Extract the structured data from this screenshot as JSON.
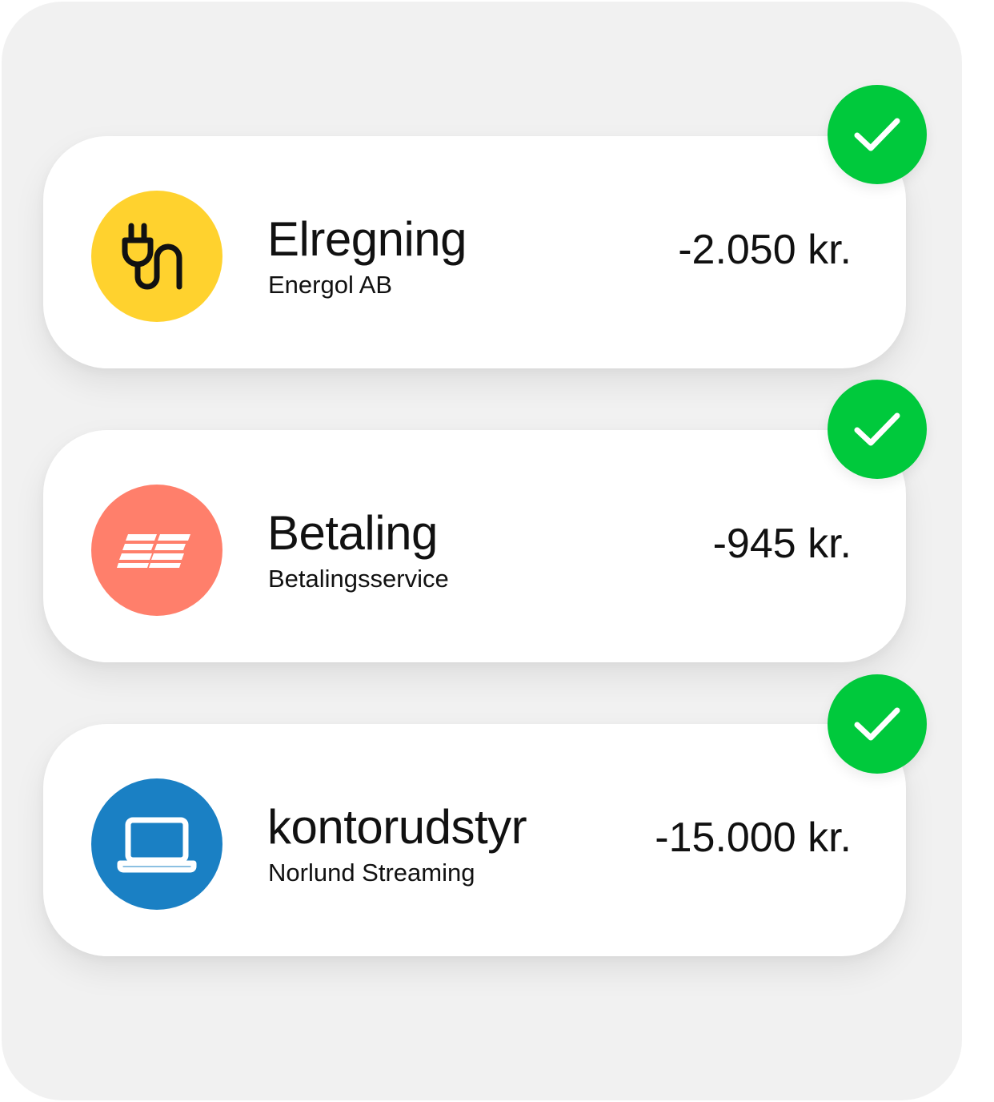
{
  "colors": {
    "panel_bg": "#f1f1f1",
    "card_bg": "#ffffff",
    "text": "#111111",
    "success": "#00c93c"
  },
  "payments": [
    {
      "title": "Elregning",
      "subtitle": "Energol AB",
      "amount": "-2.050 kr.",
      "icon": "power-plug-icon",
      "icon_bg": "#ffd22e",
      "icon_fg": "#111111",
      "status_icon": "checkmark-icon",
      "status": "completed"
    },
    {
      "title": "Betaling",
      "subtitle": "Betalingsservice",
      "amount": "-945 kr.",
      "icon": "betalingsservice-logo",
      "icon_bg": "#ff7f6b",
      "icon_fg": "#ffffff",
      "status_icon": "checkmark-icon",
      "status": "completed"
    },
    {
      "title": "kontorudstyr",
      "subtitle": "Norlund Streaming",
      "amount": "-15.000 kr.",
      "icon": "laptop-icon",
      "icon_bg": "#1a80c4",
      "icon_fg": "#ffffff",
      "status_icon": "checkmark-icon",
      "status": "completed"
    }
  ]
}
